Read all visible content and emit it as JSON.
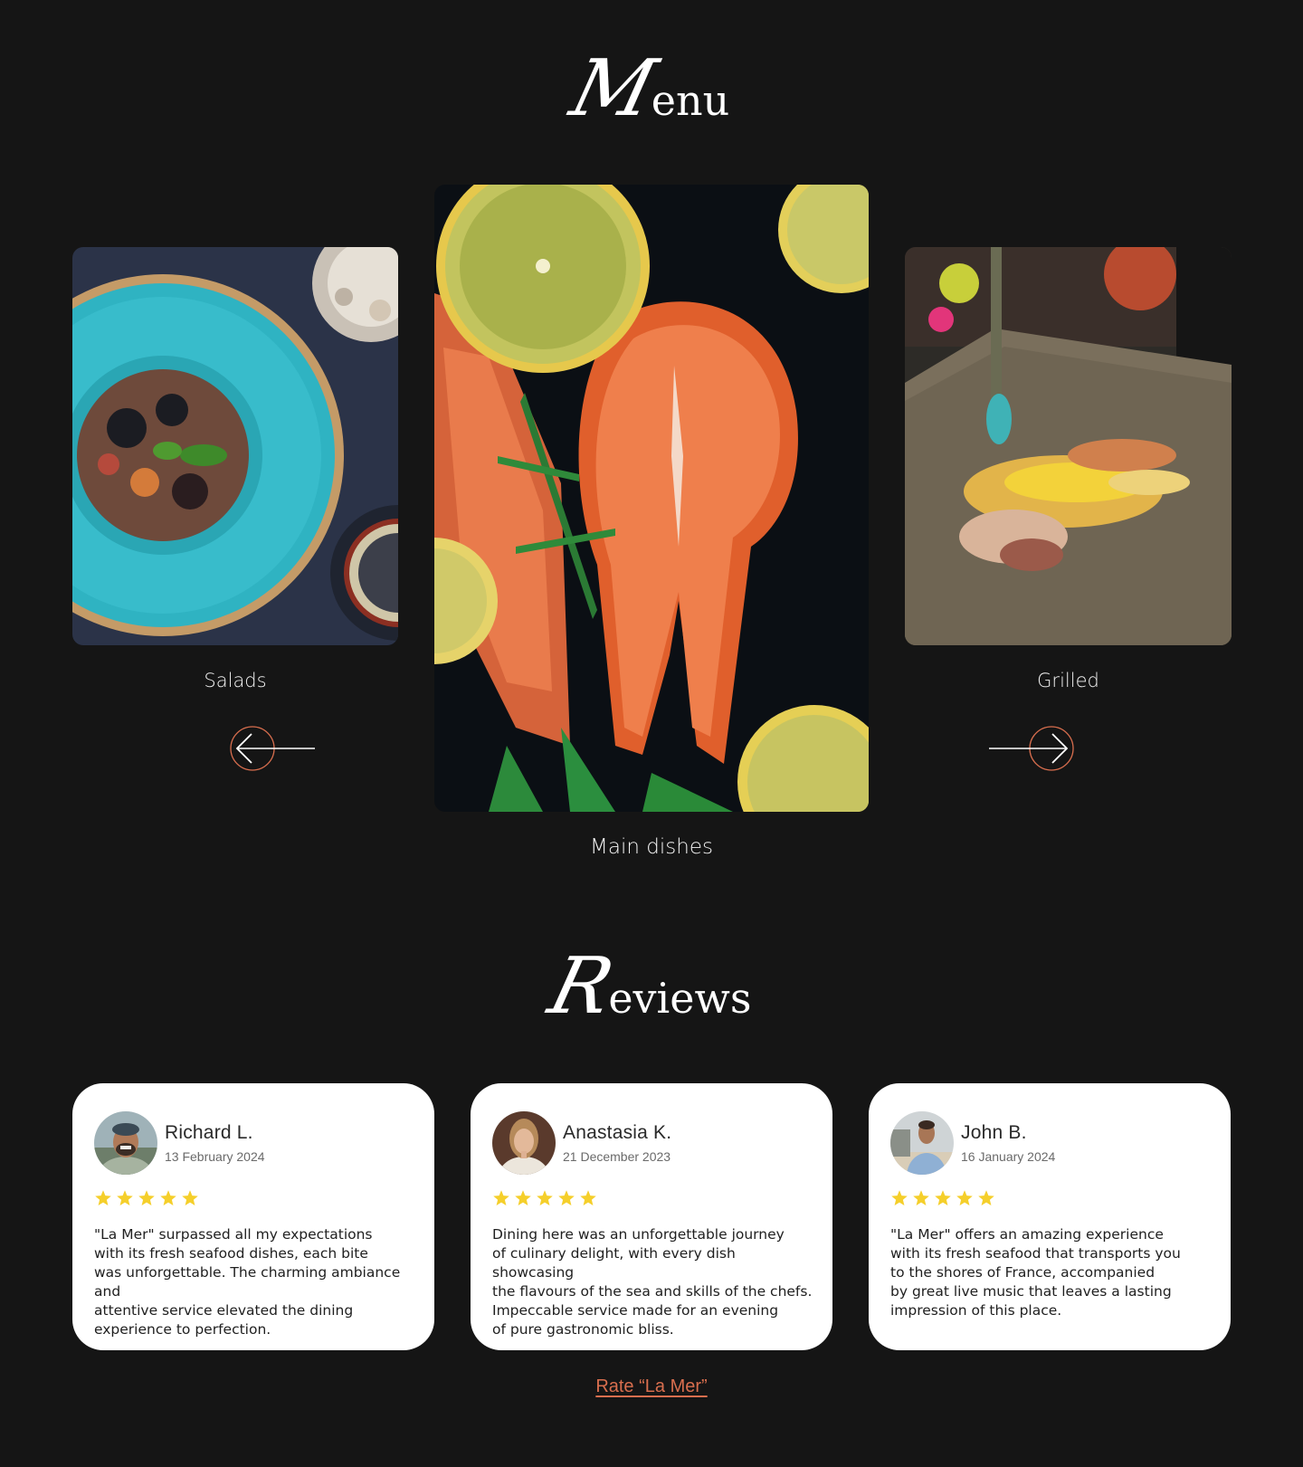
{
  "menu": {
    "title_initial": "M",
    "title_rest": "enu",
    "items": [
      {
        "label": "Salads"
      },
      {
        "label": "Main dishes"
      },
      {
        "label": "Grilled"
      }
    ],
    "prev_icon": "arrow-left-icon",
    "next_icon": "arrow-right-icon"
  },
  "reviews": {
    "title_initial": "R",
    "title_rest": "eviews",
    "items": [
      {
        "name": "Richard L.",
        "date": "13 February 2024",
        "rating": 5,
        "text": "\"La Mer\" surpassed all my expectations\nwith its fresh seafood dishes, each bite\nwas unforgettable. The charming ambiance and\nattentive service elevated the dining\nexperience to perfection."
      },
      {
        "name": "Anastasia K.",
        "date": "21 December 2023",
        "rating": 5,
        "text": "Dining here was an unforgettable journey\nof culinary delight, with every dish showcasing\nthe flavours of the sea and skills of the chefs.\nImpeccable service made for an evening\nof pure gastronomic bliss."
      },
      {
        "name": "John B.",
        "date": "16 January 2024",
        "rating": 5,
        "text": "\"La Mer\" offers an amazing experience\nwith its fresh seafood that transports you\nto the shores of France, accompanied\nby great live music that leaves a lasting\nimpression of this place."
      }
    ]
  },
  "rate_link": "Rate “La Mer”",
  "colors": {
    "background": "#151515",
    "accent": "#d86e4e",
    "star": "#f5cf2b",
    "card": "#ffffff"
  }
}
